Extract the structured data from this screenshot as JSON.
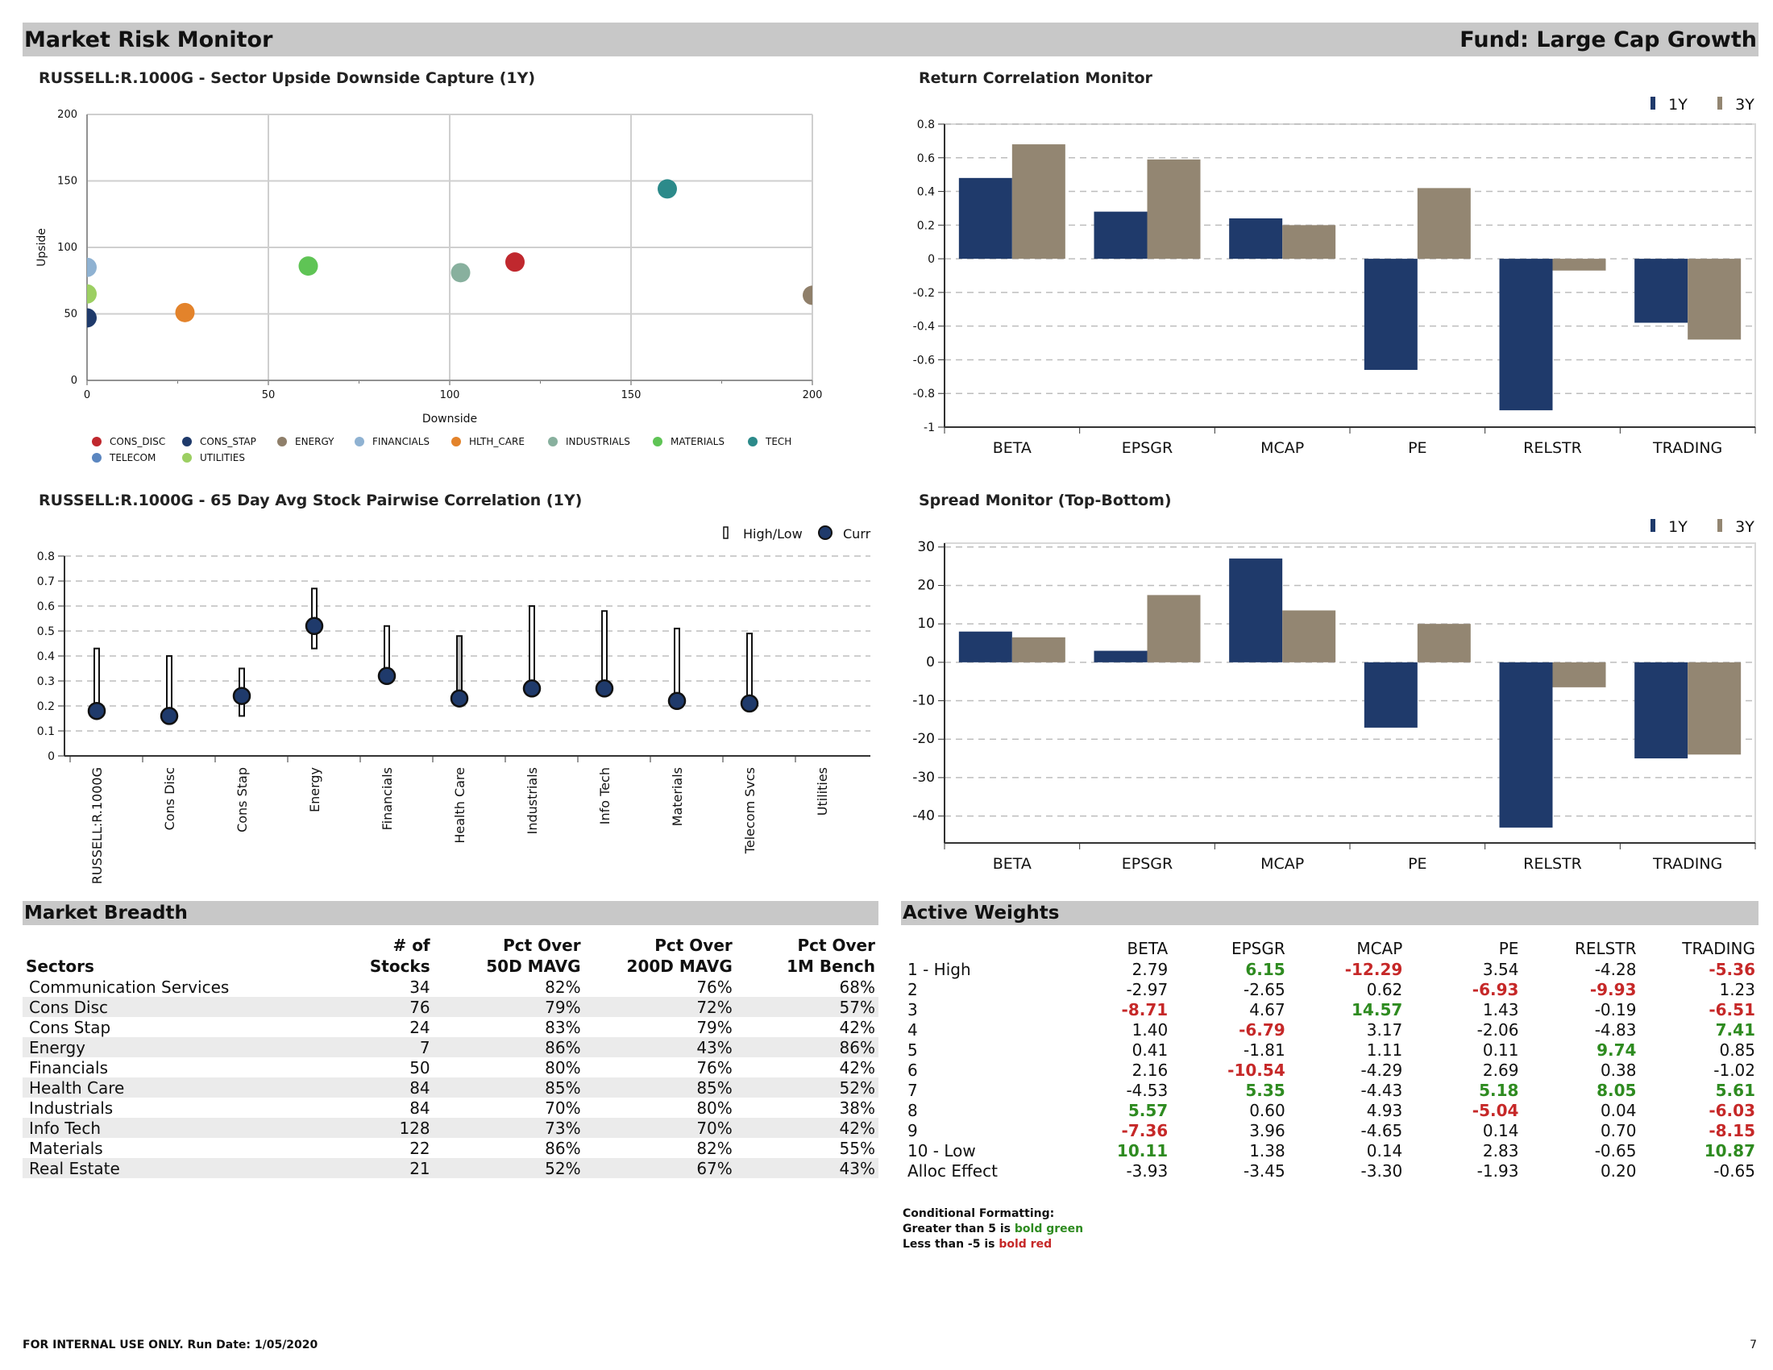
{
  "header": {
    "title": "Market Risk Monitor",
    "fund": "Fund: Large Cap Growth"
  },
  "scatter": {
    "title": "RUSSELL:R.1000G - Sector Upside Downside Capture (1Y)",
    "chart_data": {
      "type": "scatter",
      "title": "RUSSELL:R.1000G - Sector Upside Downside Capture (1Y)",
      "xlabel": "Downside",
      "ylabel": "Upside",
      "xlim": [
        0,
        200
      ],
      "ylim": [
        0,
        200
      ],
      "xticks": [
        "0",
        "50",
        "100",
        "150",
        "200"
      ],
      "yticks": [
        "0",
        "50",
        "100",
        "150",
        "200"
      ],
      "legend_position": "bottom",
      "series": [
        {
          "name": "CONS_DISC",
          "color": "#c0282e",
          "x": 118,
          "y": 89
        },
        {
          "name": "CONS_STAP",
          "color": "#1f3a6b",
          "x": 0,
          "y": 47
        },
        {
          "name": "ENERGY",
          "color": "#8f7f6a",
          "x": 200,
          "y": 64
        },
        {
          "name": "FINANCIALS",
          "color": "#8fb2d2",
          "x": 0,
          "y": 85
        },
        {
          "name": "HLTH_CARE",
          "color": "#e3832b",
          "x": 27,
          "y": 51
        },
        {
          "name": "INDUSTRIALS",
          "color": "#88b09e",
          "x": 103,
          "y": 81
        },
        {
          "name": "MATERIALS",
          "color": "#5fc455",
          "x": 61,
          "y": 86
        },
        {
          "name": "TECH",
          "color": "#2c8a8a",
          "x": 160,
          "y": 144
        },
        {
          "name": "TELECOM",
          "color": "#5b86c0",
          "x": null,
          "y": null
        },
        {
          "name": "UTILITIES",
          "color": "#9ccf62",
          "x": 0,
          "y": 65
        }
      ]
    }
  },
  "corr_monitor": {
    "title": "Return Correlation Monitor",
    "chart_data": {
      "type": "bar",
      "title": "Return Correlation Monitor",
      "categories": [
        "BETA",
        "EPSGR",
        "MCAP",
        "PE",
        "RELSTR",
        "TRADING"
      ],
      "ylim": [
        -1,
        0.8
      ],
      "yticks": [
        "0.8",
        "0.6",
        "0.4",
        "0.2",
        "0",
        "-0.2",
        "-0.4",
        "-0.6",
        "-0.8",
        "-1"
      ],
      "grid": true,
      "legend_position": "top-right",
      "series": [
        {
          "name": "1Y",
          "color": "#1f3a6b",
          "values": [
            0.48,
            0.28,
            0.24,
            -0.66,
            -0.9,
            -0.38
          ]
        },
        {
          "name": "3Y",
          "color": "#938672",
          "values": [
            0.68,
            0.59,
            0.2,
            0.42,
            -0.07,
            -0.48
          ]
        }
      ]
    }
  },
  "pairwise": {
    "title": "RUSSELL:R.1000G - 65 Day Avg Stock Pairwise Correlation (1Y)",
    "chart_data": {
      "type": "range",
      "title": "RUSSELL:R.1000G - 65 Day Avg Stock Pairwise Correlation (1Y)",
      "categories": [
        "RUSSELL:R.1000G",
        "Cons Disc",
        "Cons Stap",
        "Energy",
        "Financials",
        "Health Care",
        "Industrials",
        "Info Tech",
        "Materials",
        "Telecom Svcs",
        "Utilities"
      ],
      "ylim": [
        0,
        0.8
      ],
      "yticks": [
        "0.8",
        "0.7",
        "0.6",
        "0.5",
        "0.4",
        "0.3",
        "0.2",
        "0.1",
        "0"
      ],
      "grid": true,
      "legend_position": "top-right",
      "legend": [
        "High/Low",
        "Curr"
      ],
      "low": [
        0.17,
        0.15,
        0.16,
        0.43,
        0.31,
        0.22,
        0.26,
        0.26,
        0.21,
        0.2,
        null
      ],
      "high": [
        0.43,
        0.4,
        0.35,
        0.67,
        0.52,
        0.48,
        0.6,
        0.58,
        0.51,
        0.49,
        null
      ],
      "curr": [
        0.18,
        0.16,
        0.24,
        0.52,
        0.32,
        0.23,
        0.27,
        0.27,
        0.22,
        0.21,
        null
      ]
    }
  },
  "spread_monitor": {
    "title": "Spread Monitor (Top-Bottom)",
    "chart_data": {
      "type": "bar",
      "title": "Spread Monitor (Top-Bottom)",
      "categories": [
        "BETA",
        "EPSGR",
        "MCAP",
        "PE",
        "RELSTR",
        "TRADING"
      ],
      "ylim": [
        -47,
        31
      ],
      "yticks": [
        "30",
        "20",
        "10",
        "0",
        "-10",
        "-20",
        "-30",
        "-40"
      ],
      "grid": true,
      "legend_position": "top-right",
      "series": [
        {
          "name": "1Y",
          "color": "#1f3a6b",
          "values": [
            8,
            3,
            27,
            -17,
            -43,
            -25
          ]
        },
        {
          "name": "3Y",
          "color": "#938672",
          "values": [
            6.5,
            17.5,
            13.5,
            10,
            -6.5,
            -24
          ]
        }
      ]
    }
  },
  "market_breadth": {
    "title": "Market Breadth",
    "headers": {
      "sectors": "Sectors",
      "stocks": [
        "# of",
        "Stocks"
      ],
      "over50": [
        "Pct Over",
        "50D MAVG"
      ],
      "over200": [
        "Pct Over",
        "200D MAVG"
      ],
      "over1m": [
        "Pct Over",
        "1M Bench"
      ]
    },
    "rows": [
      [
        "Communication Services",
        "34",
        "82%",
        "76%",
        "68%"
      ],
      [
        "Cons Disc",
        "76",
        "79%",
        "72%",
        "57%"
      ],
      [
        "Cons Stap",
        "24",
        "83%",
        "79%",
        "42%"
      ],
      [
        "Energy",
        "7",
        "86%",
        "43%",
        "86%"
      ],
      [
        "Financials",
        "50",
        "80%",
        "76%",
        "42%"
      ],
      [
        "Health Care",
        "84",
        "85%",
        "85%",
        "52%"
      ],
      [
        "Industrials",
        "84",
        "70%",
        "80%",
        "38%"
      ],
      [
        "Info Tech",
        "128",
        "73%",
        "70%",
        "42%"
      ],
      [
        "Materials",
        "22",
        "86%",
        "82%",
        "55%"
      ],
      [
        "Real Estate",
        "21",
        "52%",
        "67%",
        "43%"
      ]
    ]
  },
  "active_weights": {
    "title": "Active Weights",
    "columns": [
      "BETA",
      "EPSGR",
      "MCAP",
      "PE",
      "RELSTR",
      "TRADING"
    ],
    "rows": [
      {
        "label": "1 - High",
        "values": [
          "2.79",
          "6.15",
          "-12.29",
          "3.54",
          "-4.28",
          "-5.36"
        ]
      },
      {
        "label": "2",
        "values": [
          "-2.97",
          "-2.65",
          "0.62",
          "-6.93",
          "-9.93",
          "1.23"
        ]
      },
      {
        "label": "3",
        "values": [
          "-8.71",
          "4.67",
          "14.57",
          "1.43",
          "-0.19",
          "-6.51"
        ]
      },
      {
        "label": "4",
        "values": [
          "1.40",
          "-6.79",
          "3.17",
          "-2.06",
          "-4.83",
          "7.41"
        ]
      },
      {
        "label": "5",
        "values": [
          "0.41",
          "-1.81",
          "1.11",
          "0.11",
          "9.74",
          "0.85"
        ]
      },
      {
        "label": "6",
        "values": [
          "2.16",
          "-10.54",
          "-4.29",
          "2.69",
          "0.38",
          "-1.02"
        ]
      },
      {
        "label": "7",
        "values": [
          "-4.53",
          "5.35",
          "-4.43",
          "5.18",
          "8.05",
          "5.61"
        ]
      },
      {
        "label": "8",
        "values": [
          "5.57",
          "0.60",
          "4.93",
          "-5.04",
          "0.04",
          "-6.03"
        ]
      },
      {
        "label": "9",
        "values": [
          "-7.36",
          "3.96",
          "-4.65",
          "0.14",
          "0.70",
          "-8.15"
        ]
      },
      {
        "label": "10 - Low",
        "values": [
          "10.11",
          "1.38",
          "0.14",
          "2.83",
          "-0.65",
          "10.87"
        ]
      },
      {
        "label": "Alloc Effect",
        "values": [
          "-3.93",
          "-3.45",
          "-3.30",
          "-1.93",
          "0.20",
          "-0.65"
        ]
      }
    ]
  },
  "notes": {
    "line1": "Conditional Formatting:",
    "line2_prefix": "Greater than 5 is ",
    "line2_em": "bold green",
    "line3_prefix": "Less than -5 is ",
    "line3_em": "bold red"
  },
  "footer": {
    "text": "FOR INTERNAL USE ONLY. Run Date: 1/05/2020",
    "page": "7"
  }
}
